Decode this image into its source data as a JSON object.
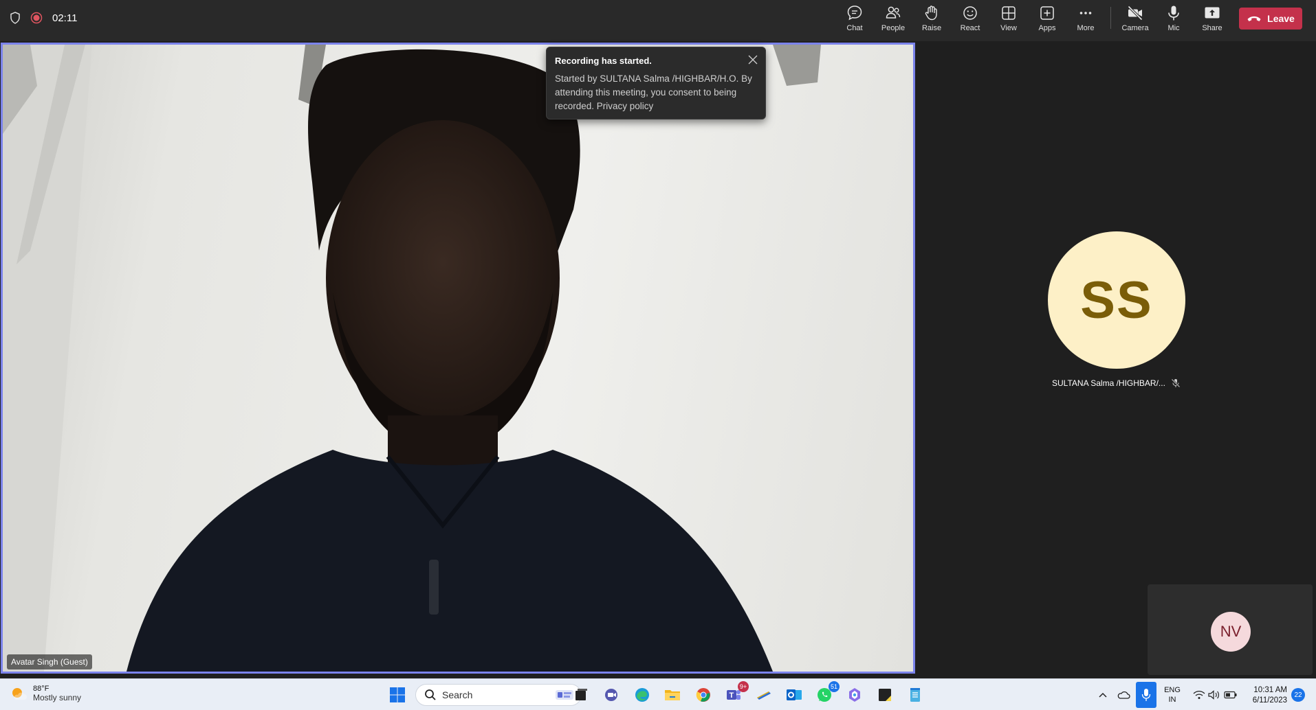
{
  "meeting": {
    "timer": "02:11"
  },
  "toolbar": {
    "items": [
      {
        "label": "Chat",
        "icon": "chat-icon"
      },
      {
        "label": "People",
        "icon": "people-icon"
      },
      {
        "label": "Raise",
        "icon": "hand-icon"
      },
      {
        "label": "React",
        "icon": "smiley-icon"
      },
      {
        "label": "View",
        "icon": "view-grid-icon"
      },
      {
        "label": "Apps",
        "icon": "apps-plus-icon"
      },
      {
        "label": "More",
        "icon": "more-dots-icon"
      },
      {
        "label": "Camera",
        "icon": "camera-off-icon"
      },
      {
        "label": "Mic",
        "icon": "mic-icon"
      },
      {
        "label": "Share",
        "icon": "share-icon"
      }
    ],
    "leave_label": "Leave",
    "leave_color": "#c4314b"
  },
  "main_video": {
    "participant_name": "Avatar Singh (Guest)",
    "highlight_color": "#7b83eb"
  },
  "toast": {
    "title": "Recording has started.",
    "body": "Started by SULTANA Salma /HIGHBAR/H.O. By attending this meeting, you consent to being recorded. Privacy policy"
  },
  "participants": [
    {
      "initials": "SS",
      "name": "SULTANA Salma /HIGHBAR/...",
      "muted": true,
      "avatar_bg": "#fdf0c7",
      "avatar_fg": "#7a5d08"
    },
    {
      "initials": "NV",
      "avatar_bg": "#f5d9dc",
      "avatar_fg": "#7a1f2c"
    }
  ],
  "taskbar": {
    "weather": {
      "temp": "88°F",
      "desc": "Mostly sunny"
    },
    "search_label": "Search",
    "teams_badge": "9+",
    "whatsapp_badge": "51",
    "language": {
      "line1": "ENG",
      "line2": "IN"
    },
    "clock": {
      "time": "10:31 AM",
      "date": "6/11/2023"
    },
    "notification_count": "22"
  }
}
